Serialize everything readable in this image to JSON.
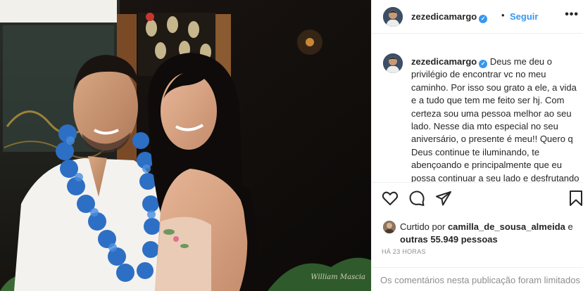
{
  "post": {
    "username": "zezedicamargo",
    "verified_icon": "verified-badge-icon",
    "separator": "•",
    "follow_label": "Seguir",
    "more_icon": "more-options-icon",
    "more_glyph": "•••",
    "caption_text": "Deus me deu o privilégio de encontrar vc no meu caminho. Por isso sou grato a ele, a vida e a tudo que tem me feito ser hj. Com certeza sou uma pessoa melhor ao seu lado. Nesse dia mto especial no seu aniversário, o presente é meu!! Quero q Deus continue te iluminando, te abençoando e principalmente que eu possa continuar a seu lado e desfrutando dessa coisa linda, que é a",
    "photo_watermark": "William Mascia",
    "actions": {
      "like_icon": "heart-icon",
      "comment_icon": "comment-icon",
      "share_icon": "share-icon",
      "save_icon": "bookmark-icon"
    },
    "likes": {
      "prefix": "Curtido por",
      "first_user": "camilla_de_sousa_almeida",
      "connector": "e",
      "others": "outras 55.949 pessoas"
    },
    "timestamp": "HÁ 23 HORAS",
    "comments_disabled": "Os comentários nesta publicação foram limitados"
  },
  "colors": {
    "accent": "#3897f0",
    "text": "#262626",
    "muted": "#8e8e8e",
    "border": "#efefef"
  }
}
